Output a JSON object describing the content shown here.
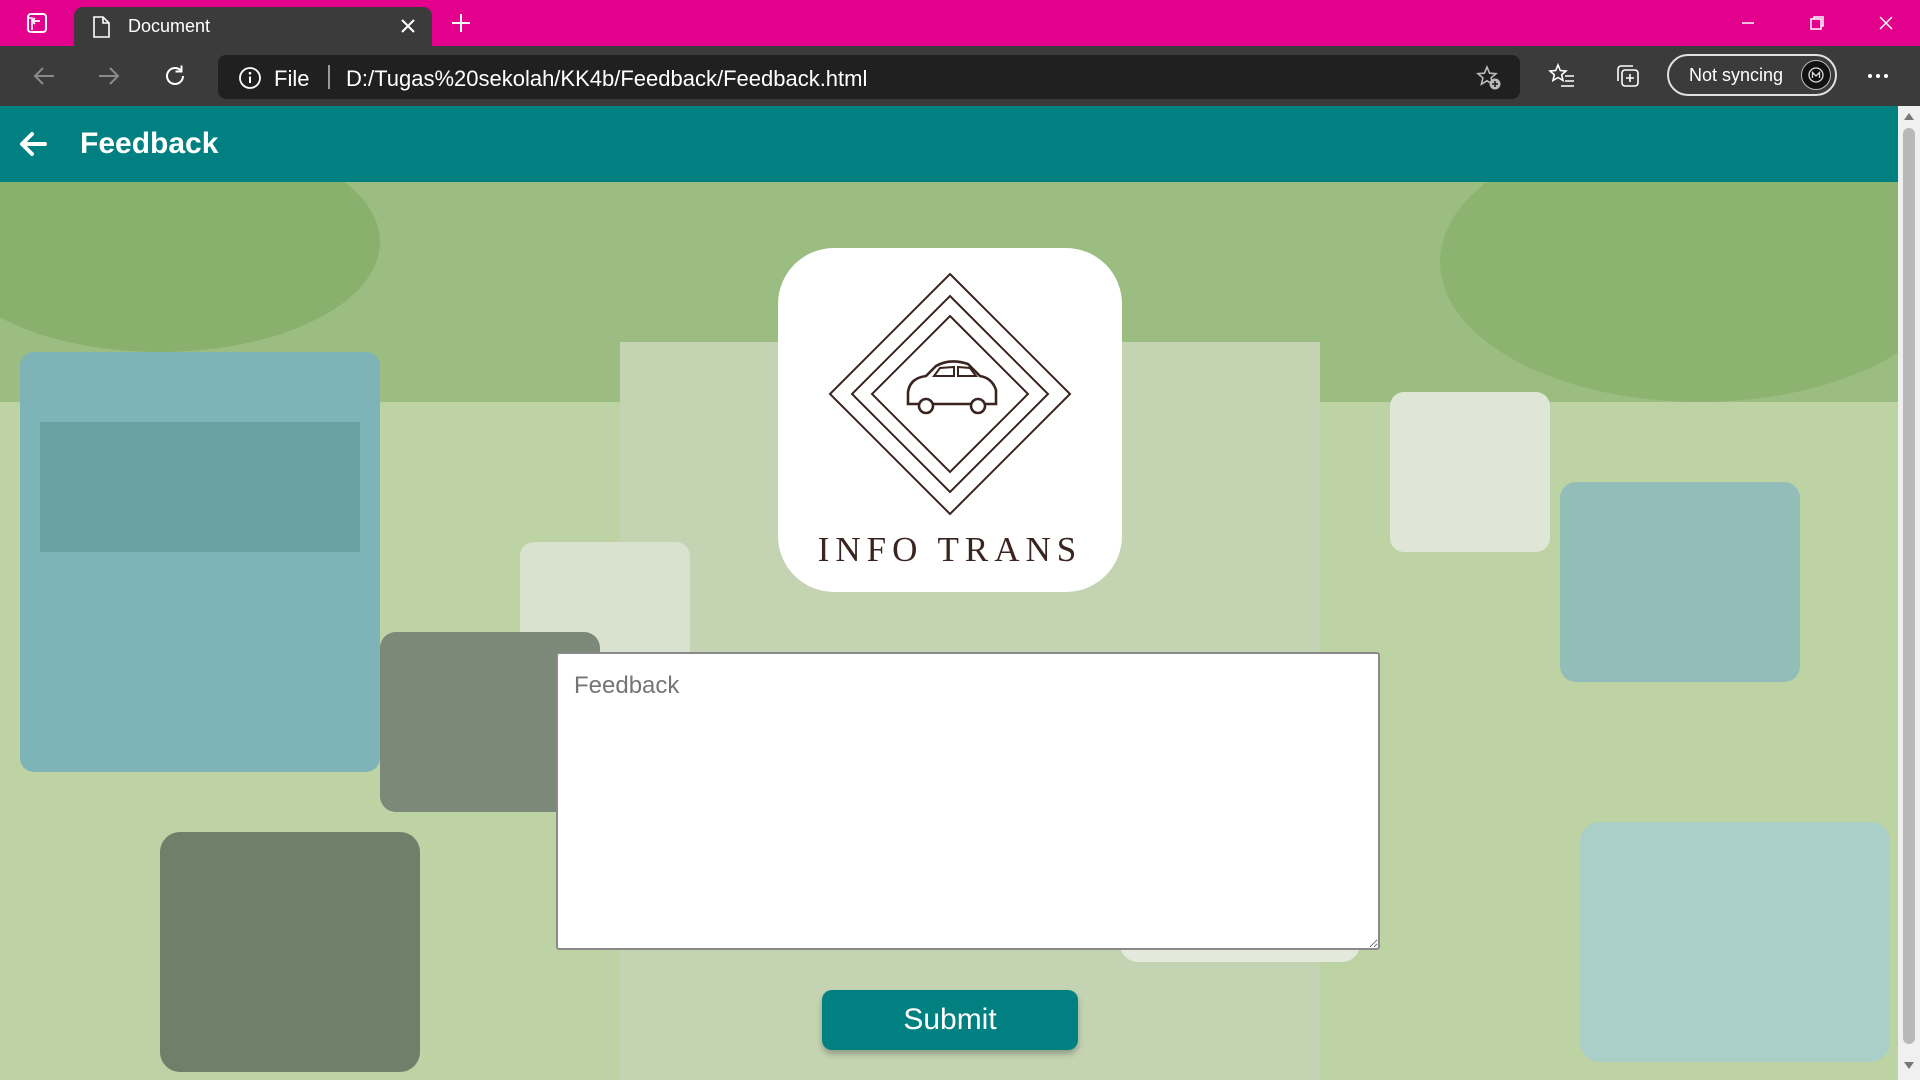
{
  "browser": {
    "tab_title": "Document",
    "address_prefix": "File",
    "url": "D:/Tugas%20sekolah/KK4b/Feedback/Feedback.html",
    "sync_label": "Not syncing",
    "colors": {
      "tabbar": "#e3008c",
      "toolbar": "#3b3b3b",
      "address": "#202020"
    }
  },
  "appbar": {
    "title": "Feedback",
    "color": "#008080"
  },
  "logo": {
    "text": "INFO TRANS"
  },
  "form": {
    "feedback_placeholder": "Feedback",
    "feedback_value": "",
    "submit_label": "Submit"
  },
  "icons": {
    "tab_actions": "tab-actions-icon",
    "document": "document-icon",
    "close_tab": "close-icon",
    "new_tab": "plus-icon",
    "minimize": "minimize-icon",
    "restore": "restore-icon",
    "close_window": "close-icon",
    "back": "arrow-left-icon",
    "forward": "arrow-right-icon",
    "refresh": "refresh-icon",
    "site_info": "info-icon",
    "add_favorite": "star-plus-icon",
    "favorites": "favorites-icon",
    "collections": "collections-icon",
    "menu": "more-icon",
    "app_back": "arrow-left-icon"
  }
}
